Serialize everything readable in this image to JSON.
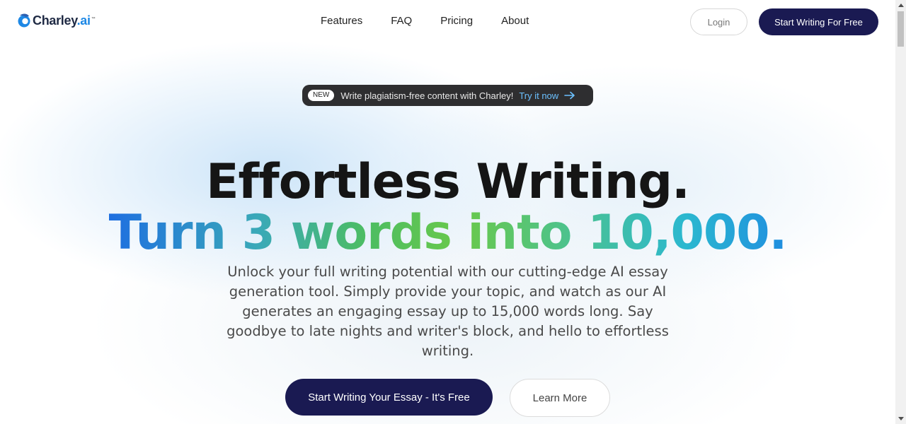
{
  "header": {
    "logo": {
      "text": "Charley",
      "dot": ".ai",
      "tm": "™"
    },
    "nav": [
      {
        "label": "Features"
      },
      {
        "label": "FAQ"
      },
      {
        "label": "Pricing"
      },
      {
        "label": "About"
      }
    ],
    "login_label": "Login",
    "start_label": "Start Writing For Free"
  },
  "announcement": {
    "badge": "NEW",
    "text": "Write plagiatism-free content with Charley!",
    "link": "Try it now",
    "arrow_icon": "arrow-right-icon"
  },
  "hero": {
    "title_line1": "Effortless Writing.",
    "title_line2": "Turn 3 words into 10,000.",
    "subtitle": "Unlock your full writing potential with our cutting-edge AI essay generation tool. Simply provide your topic, and watch as our AI generates an engaging essay up to 15,000 words long. Say goodbye to late nights and writer's block, and hello to effortless writing.",
    "cta_label": "Start Writing Your Essay - It's Free",
    "learn_label": "Learn More"
  },
  "colors": {
    "brand_navy": "#1a1a52",
    "accent_blue": "#1e88e5",
    "gradient": [
      "#1e6fe0",
      "#4cbd62",
      "#6ac94a",
      "#2bb8cf"
    ]
  }
}
